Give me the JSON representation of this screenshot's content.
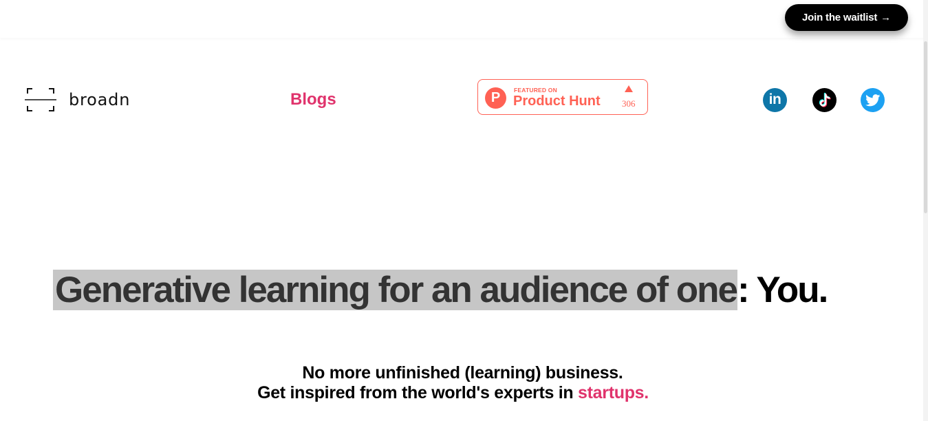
{
  "header": {
    "cta_label": "Join the waitlist",
    "cta_arrow": "→"
  },
  "nav": {
    "brand": "broadn",
    "blogs_label": "Blogs",
    "product_hunt": {
      "featured_label": "FEATURED ON",
      "name": "Product Hunt",
      "logo_letter": "P",
      "upvotes": "306"
    },
    "social": [
      {
        "name": "linkedin-icon",
        "label": "in"
      },
      {
        "name": "tiktok-icon"
      },
      {
        "name": "twitter-icon"
      }
    ]
  },
  "hero": {
    "headline_highlight": "Generative learning for an audience of one",
    "headline_rest": ": You.",
    "subline_1": "No more unfinished (learning) business.",
    "subline_2_prefix": "Get inspired from the world's experts in ",
    "subline_2_accent": "startups."
  },
  "colors": {
    "accent": "#e0336c",
    "product_hunt": "#ff6154",
    "linkedin": "#0e76a8",
    "twitter": "#1da1f2",
    "highlight_bg": "#c6c6c6"
  }
}
